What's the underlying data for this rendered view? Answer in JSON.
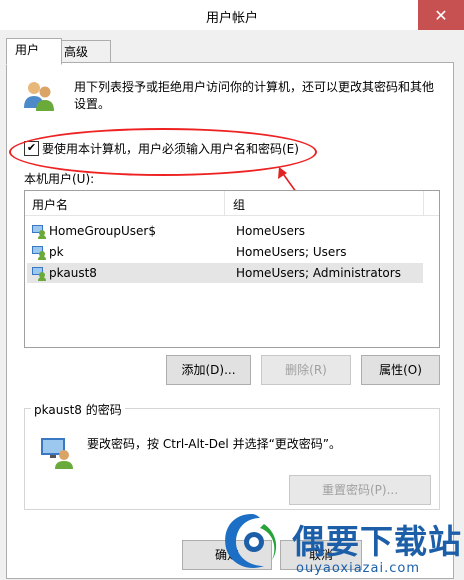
{
  "window": {
    "title": "用户帐户",
    "close_glyph": "✕"
  },
  "tabs": [
    {
      "label": "用户"
    },
    {
      "label": "高级"
    }
  ],
  "intro": {
    "text": "用下列表授予或拒绝用户访问你的计算机，还可以更改其密码和其他设置。"
  },
  "require_login": {
    "label": "要使用本计算机，用户必须输入用户名和密码(E)",
    "checked": true,
    "check_glyph": "✔"
  },
  "users_section": {
    "label": "本机用户(U):"
  },
  "user_list": {
    "columns": [
      "用户名",
      "组"
    ],
    "rows": [
      {
        "name": "HomeGroupUser$",
        "group": "HomeUsers",
        "selected": false
      },
      {
        "name": "pk",
        "group": "HomeUsers; Users",
        "selected": false
      },
      {
        "name": "pkaust8",
        "group": "HomeUsers; Administrators",
        "selected": true
      }
    ]
  },
  "buttons": {
    "add": "添加(D)...",
    "remove": "删除(R)",
    "properties": "属性(O)"
  },
  "password_group": {
    "title": "pkaust8 的密码",
    "text": "要改密码，按 Ctrl-Alt-Del 并选择“更改密码”。",
    "reset_button": "重置密码(P)..."
  },
  "footer": {
    "ok": "确定",
    "cancel": "取消"
  },
  "watermark": {
    "title": "偶要下载站",
    "url": "ouyaoxiazai.com"
  },
  "colors": {
    "annotation_red": "#e22222",
    "close_red": "#c75050",
    "watermark_blue": "#1c5fa8"
  }
}
